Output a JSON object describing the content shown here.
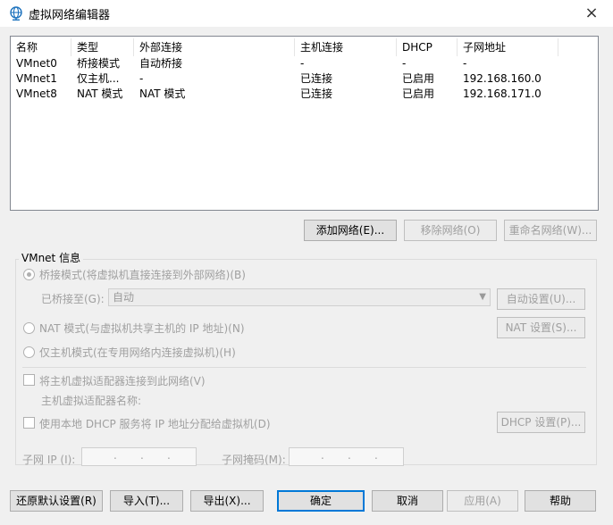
{
  "window": {
    "title": "虚拟网络编辑器",
    "close_icon": "×"
  },
  "table": {
    "columns": [
      "名称",
      "类型",
      "外部连接",
      "主机连接",
      "DHCP",
      "子网地址"
    ],
    "rows": [
      [
        "VMnet0",
        "桥接模式",
        "自动桥接",
        "-",
        "-",
        "-"
      ],
      [
        "VMnet1",
        "仅主机...",
        "-",
        "已连接",
        "已启用",
        "192.168.160.0"
      ],
      [
        "VMnet8",
        "NAT 模式",
        "NAT 模式",
        "已连接",
        "已启用",
        "192.168.171.0"
      ]
    ]
  },
  "table_buttons": {
    "add": "添加网络(E)...",
    "remove": "移除网络(O)",
    "rename": "重命名网络(W)..."
  },
  "vmnet_info": {
    "title": "VMnet 信息",
    "bridged_label": "桥接模式(将虚拟机直接连接到外部网络)(B)",
    "bridged_to_label": "已桥接至(G):",
    "bridged_to_value": "自动",
    "auto_settings": "自动设置(U)...",
    "nat_label": "NAT 模式(与虚拟机共享主机的 IP 地址)(N)",
    "nat_settings": "NAT 设置(S)...",
    "hostonly_label": "仅主机模式(在专用网络内连接虚拟机)(H)",
    "connect_adapter_label": "将主机虚拟适配器连接到此网络(V)",
    "adapter_name_label": "主机虚拟适配器名称:",
    "dhcp_label": "使用本地 DHCP 服务将 IP 地址分配给虚拟机(D)",
    "dhcp_settings": "DHCP 设置(P)...",
    "subnet_ip_label": "子网 IP (I):",
    "subnet_mask_label": "子网掩码(M):"
  },
  "footer": {
    "restore": "还原默认设置(R)",
    "import": "导入(T)...",
    "export": "导出(X)...",
    "ok": "确定",
    "cancel": "取消",
    "apply": "应用(A)",
    "help": "帮助"
  },
  "colors": {
    "accent": "#0078d7",
    "globe": "#1e73be"
  }
}
